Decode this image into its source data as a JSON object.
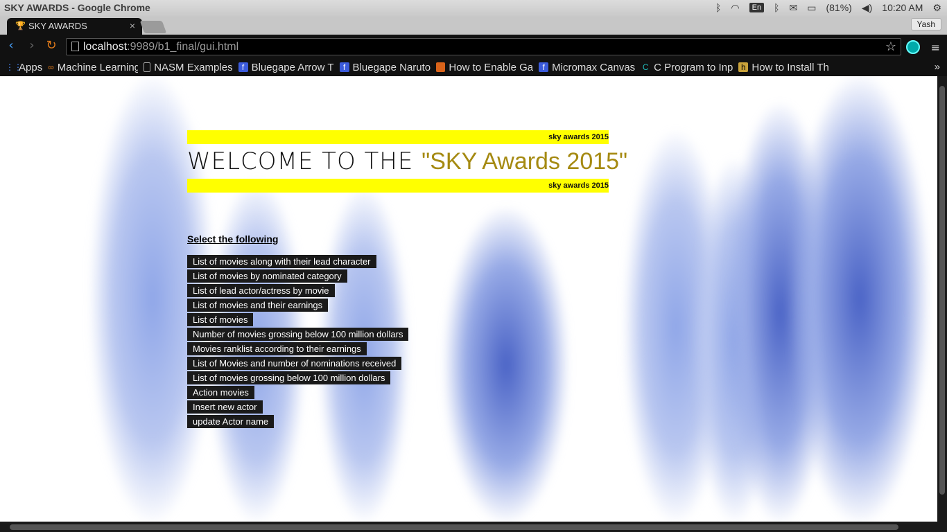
{
  "os": {
    "window_title": "SKY AWARDS - Google Chrome",
    "battery": "(81%)",
    "lang": "En",
    "time": "10:20 AM"
  },
  "browser": {
    "tab_title": "SKY AWARDS",
    "profile": "Yash",
    "url_host": "localhost",
    "url_path": ":9989/b1_final/gui.html"
  },
  "bookmarks": [
    {
      "label": "Apps",
      "icon": "apps-grid-icon"
    },
    {
      "label": "Machine Learning",
      "icon": "infinity-icon"
    },
    {
      "label": "NASM Examples",
      "icon": "page-icon"
    },
    {
      "label": "Bluegape Arrow T",
      "icon": "facebook-icon"
    },
    {
      "label": "Bluegape Naruto",
      "icon": "facebook-icon"
    },
    {
      "label": "How to Enable Ga",
      "icon": "box-icon"
    },
    {
      "label": "Micromax Canvas",
      "icon": "facebook-icon"
    },
    {
      "label": "C Program to Inp",
      "icon": "c-icon"
    },
    {
      "label": "How to Install Th",
      "icon": "h-icon"
    }
  ],
  "page": {
    "banner_text": "sky awards 2015",
    "welcome_prefix": "WELCOME TO THE ",
    "welcome_highlight": "\"SKY Awards 2015\"",
    "select_title": "Select the following",
    "options": [
      "List of movies along with their lead character",
      "List of movies by nominated category",
      "List of lead actor/actress by movie",
      "List of movies and their earnings",
      "List of movies",
      "Number of movies grossing below 100 million dollars",
      "Movies ranklist according to their earnings",
      "List of Movies and number of nominations received",
      "List of movies grossing below 100 million dollars",
      "Action movies",
      "Insert new actor",
      "update Actor name"
    ]
  },
  "colors": {
    "banner": "#ffff00",
    "highlight": "#a58a12",
    "button_bg": "#1a1a1a"
  }
}
